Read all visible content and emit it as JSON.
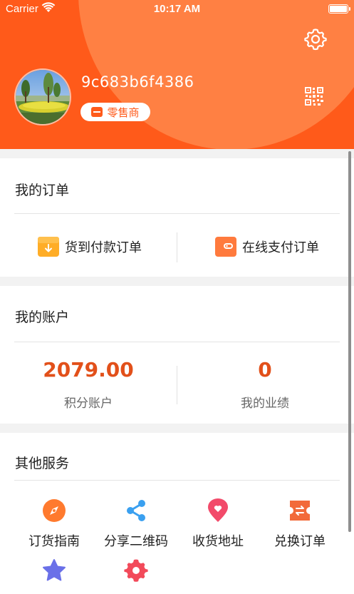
{
  "status_bar": {
    "carrier": "Carrier",
    "time": "10:17 AM"
  },
  "profile": {
    "username": "9c683b6f4386",
    "role_badge": "零售商"
  },
  "orders": {
    "title": "我的订单",
    "items": [
      {
        "label": "货到付款订单",
        "icon": "cash-on-delivery-icon"
      },
      {
        "label": "在线支付订单",
        "icon": "wallet-icon"
      }
    ]
  },
  "account": {
    "title": "我的账户",
    "stats": [
      {
        "value": "2079.00",
        "label": "积分账户"
      },
      {
        "value": "0",
        "label": "我的业绩"
      }
    ]
  },
  "services": {
    "title": "其他服务",
    "items": [
      {
        "label": "订货指南",
        "icon": "compass-icon"
      },
      {
        "label": "分享二维码",
        "icon": "share-icon"
      },
      {
        "label": "收货地址",
        "icon": "location-pin-icon"
      },
      {
        "label": "兑换订单",
        "icon": "exchange-ticket-icon"
      },
      {
        "label": "",
        "icon": "star-icon"
      },
      {
        "label": "",
        "icon": "settings-gear-icon"
      }
    ]
  },
  "colors": {
    "brand": "#ff5a1a",
    "accent_number": "#e2501a"
  }
}
